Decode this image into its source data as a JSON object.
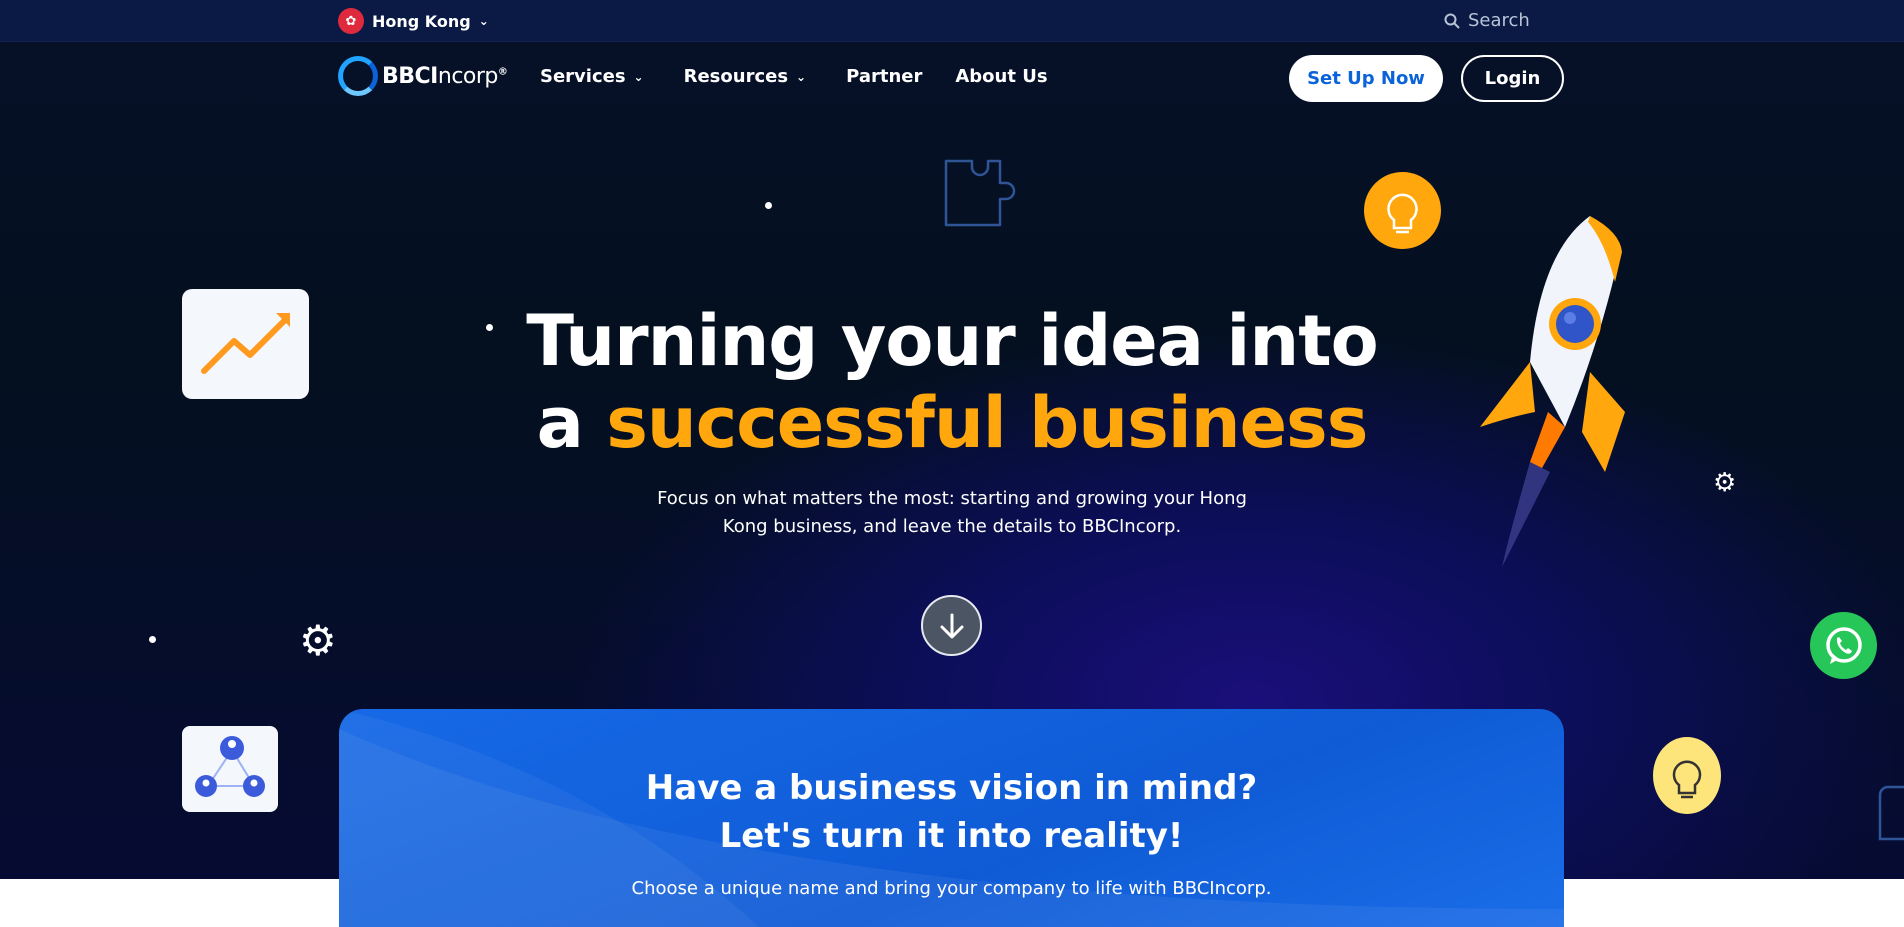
{
  "topbar": {
    "region": "Hong Kong",
    "search_placeholder": "Search"
  },
  "brand": {
    "logo_bold": "BBCI",
    "logo_thin": "ncorp",
    "logo_mark": "®"
  },
  "nav": {
    "items": [
      "Services",
      "Resources",
      "Partner",
      "About Us"
    ]
  },
  "actions": {
    "setup": "Set Up Now",
    "login": "Login"
  },
  "hero": {
    "title_line1": "Turning your idea into",
    "title_line2_plain": "a ",
    "title_line2_accent": "successful business",
    "subtitle": "Focus on what matters the most: starting and growing your Hong Kong business, and leave the details to BBCIncorp."
  },
  "vision": {
    "title_line1": "Have a business vision in mind?",
    "title_line2": "Let's turn it into reality!",
    "subtitle": "Choose a unique name and bring your company to life with BBCIncorp."
  },
  "colors": {
    "accent": "#ffa70d",
    "primary": "#0a63d8",
    "whatsapp": "#27c658"
  }
}
